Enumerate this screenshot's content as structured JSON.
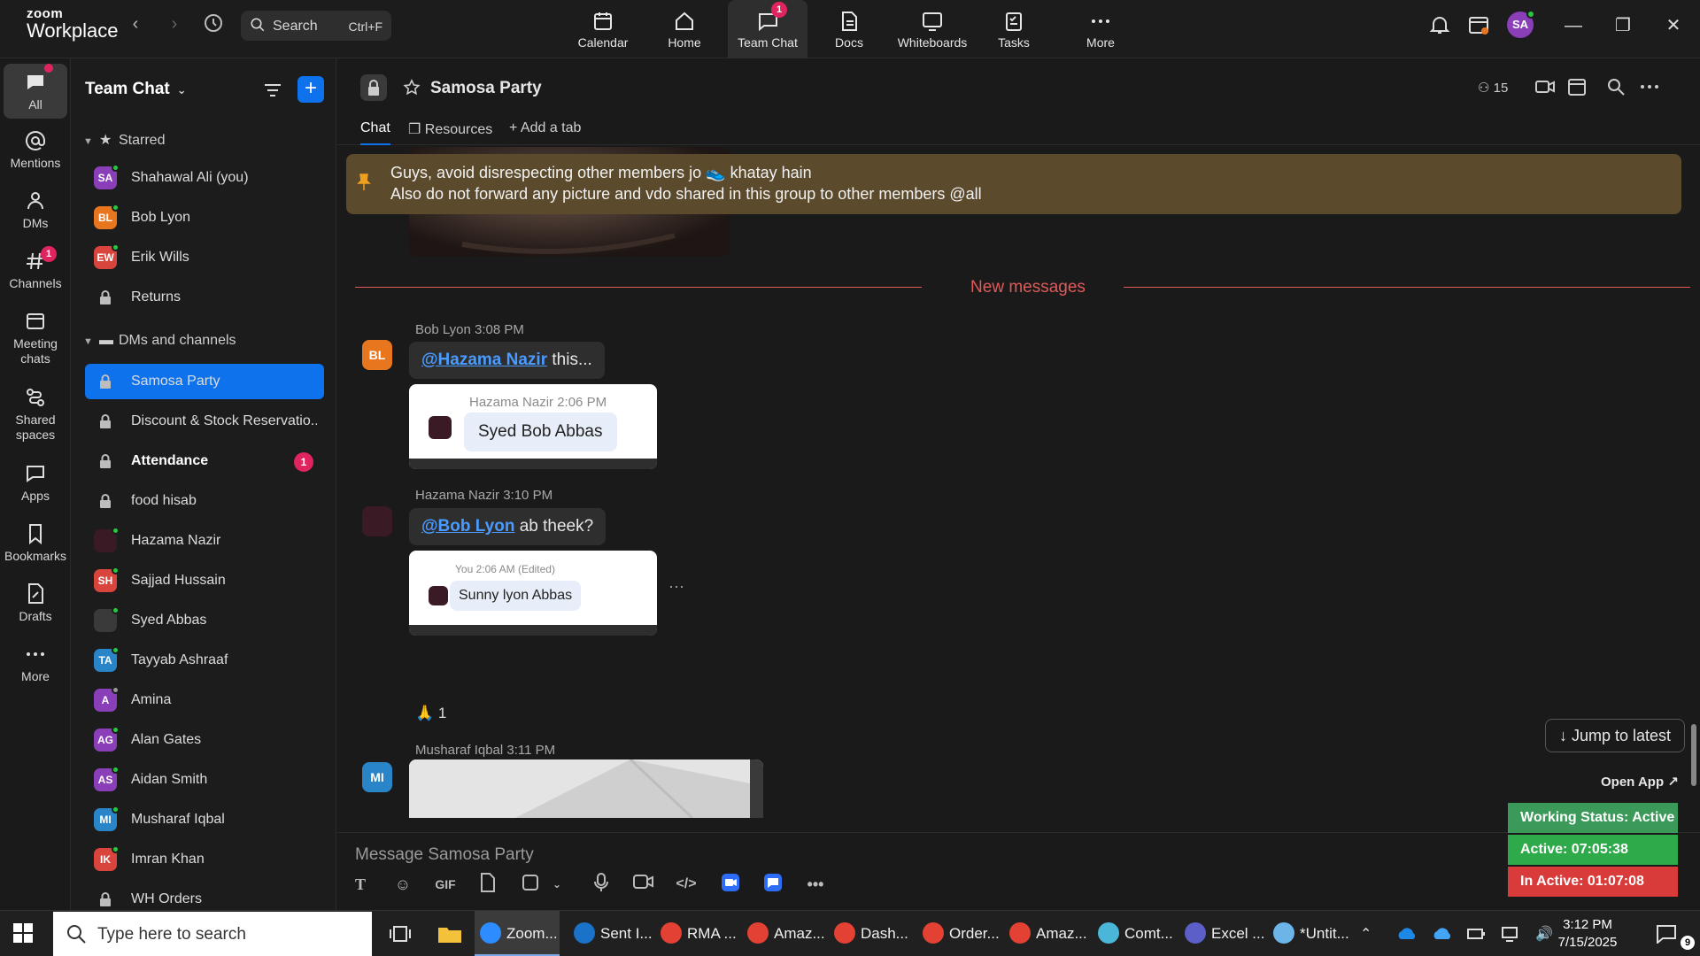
{
  "topbar": {
    "logo_line1": "zoom",
    "logo_line2": "Workplace",
    "search_label": "Search",
    "search_shortcut": "Ctrl+F",
    "tabs": [
      {
        "label": "Calendar",
        "icon": "calendar-icon"
      },
      {
        "label": "Home",
        "icon": "home-icon"
      },
      {
        "label": "Team Chat",
        "icon": "chat-icon",
        "badge": "1",
        "active": true
      },
      {
        "label": "Docs",
        "icon": "docs-icon"
      },
      {
        "label": "Whiteboards",
        "icon": "whiteboard-icon"
      },
      {
        "label": "Tasks",
        "icon": "tasks-icon"
      },
      {
        "label": "More",
        "icon": "more-icon"
      }
    ],
    "avatar_initials": "SA"
  },
  "rail": {
    "items": [
      {
        "label": "All",
        "icon": "chat-icon"
      },
      {
        "label": "Mentions",
        "icon": "at-icon"
      },
      {
        "label": "DMs",
        "icon": "people-icon"
      },
      {
        "label": "Channels",
        "icon": "hash-icon",
        "badge": "1"
      },
      {
        "label": "Meeting chats",
        "icon": "meeting-chat-icon"
      },
      {
        "label": "Shared spaces",
        "icon": "shared-spaces-icon"
      },
      {
        "label": "Apps",
        "icon": "apps-icon"
      },
      {
        "label": "Bookmarks",
        "icon": "bookmark-icon"
      },
      {
        "label": "Drafts",
        "icon": "drafts-icon"
      },
      {
        "label": "More",
        "icon": "more-icon"
      }
    ]
  },
  "sidebar": {
    "title": "Team Chat",
    "starred_label": "Starred",
    "dms_label": "DMs and channels",
    "starred": [
      {
        "name": "Shahawal Ali (you)",
        "initials": "SA",
        "color": "#8a3fb8",
        "status": "online"
      },
      {
        "name": "Bob Lyon",
        "initials": "BL",
        "color": "#e8761e",
        "status": "online"
      },
      {
        "name": "Erik Wills",
        "initials": "EW",
        "color": "#d9453c",
        "status": "online"
      },
      {
        "name": "Returns",
        "type": "channel"
      }
    ],
    "dms": [
      {
        "name": "Samosa Party",
        "type": "channel",
        "selected": true
      },
      {
        "name": "Discount & Stock Reservatio...",
        "type": "channel"
      },
      {
        "name": "Attendance",
        "type": "channel",
        "bold": true,
        "badge": "1"
      },
      {
        "name": "food hisab",
        "type": "channel"
      },
      {
        "name": "Hazama Nazir",
        "initials": "",
        "color": "#3a1a24",
        "status": "online"
      },
      {
        "name": "Sajjad Hussain",
        "initials": "SH",
        "color": "#d9453c",
        "status": "online"
      },
      {
        "name": "Syed Abbas",
        "initials": "",
        "color": "#3a3a3a",
        "status": "online"
      },
      {
        "name": "Tayyab Ashraaf",
        "initials": "TA",
        "color": "#2a84c8",
        "status": "online"
      },
      {
        "name": "Amina",
        "initials": "A",
        "color": "#8a3fb8",
        "status": "away"
      },
      {
        "name": "Alan Gates",
        "initials": "AG",
        "color": "#8a3fb8",
        "status": "online"
      },
      {
        "name": "Aidan Smith",
        "initials": "AS",
        "color": "#8a3fb8",
        "status": "online"
      },
      {
        "name": "Musharaf Iqbal",
        "initials": "MI",
        "color": "#2a84c8",
        "status": "online"
      },
      {
        "name": "Imran Khan",
        "initials": "IK",
        "color": "#d9453c",
        "status": "online"
      },
      {
        "name": "WH Orders",
        "type": "channel"
      }
    ]
  },
  "chat": {
    "channel_name": "Samosa Party",
    "member_count": "15",
    "tabs": [
      "Chat",
      "Resources",
      "Add a tab"
    ],
    "pinned_line1": "Guys, avoid disrespecting other members jo 👟 khatay hain",
    "pinned_line2": "Also do not forward any picture and vdo shared in this group to other members @all",
    "new_messages_label": "New messages",
    "messages": [
      {
        "author": "Bob Lyon",
        "time": "3:08 PM",
        "initials": "BL",
        "color": "#e8761e",
        "mention": "@Hazama Nazir",
        "text": " this...",
        "quote_author": "Hazama Nazir",
        "quote_time": "2:06 PM",
        "quote_text": "Syed Bob Abbas"
      },
      {
        "author": "Hazama Nazir",
        "time": "3:10 PM",
        "initials": "",
        "color": "#3a1a24",
        "mention": "@Bob Lyon",
        "text": " ab theek?",
        "quote_author": "You",
        "quote_time": "2:06 AM (Edited)",
        "quote_text": "Sunny lyon Abbas",
        "reaction": "🙏 1"
      },
      {
        "author": "Musharaf Iqbal",
        "time": "3:11 PM",
        "initials": "MI",
        "color": "#2a84c8"
      }
    ],
    "jump_label": "Jump to latest",
    "composer_placeholder": "Message Samosa Party",
    "toolbar_gif": "GIF"
  },
  "extension": {
    "open_app": "Open App ↗",
    "working_status": "Working Status: Active",
    "active_time": "Active: 07:05:38",
    "inactive_time": "In Active: 01:07:08",
    "colors": {
      "status": "#3b9a5a",
      "active": "#2eaa4a",
      "inactive": "#d93b3b"
    }
  },
  "taskbar": {
    "search_placeholder": "Type here to search",
    "apps": [
      {
        "label": "Zoom...",
        "color": "#2d8cff",
        "active": true
      },
      {
        "label": "Sent I...",
        "color": "#1a73c8"
      },
      {
        "label": "RMA ...",
        "color": "#e34133"
      },
      {
        "label": "Amaz...",
        "color": "#e34133"
      },
      {
        "label": "Dash...",
        "color": "#e34133"
      },
      {
        "label": "Order...",
        "color": "#e34133"
      },
      {
        "label": "Amaz...",
        "color": "#e34133"
      },
      {
        "label": "Comt...",
        "color": "#4ab6d8"
      },
      {
        "label": "Excel ...",
        "color": "#5b5fc7"
      },
      {
        "label": "*Untit...",
        "color": "#6bb5e8"
      }
    ],
    "time": "3:12 PM",
    "date": "7/15/2025",
    "notif_count": "9"
  }
}
